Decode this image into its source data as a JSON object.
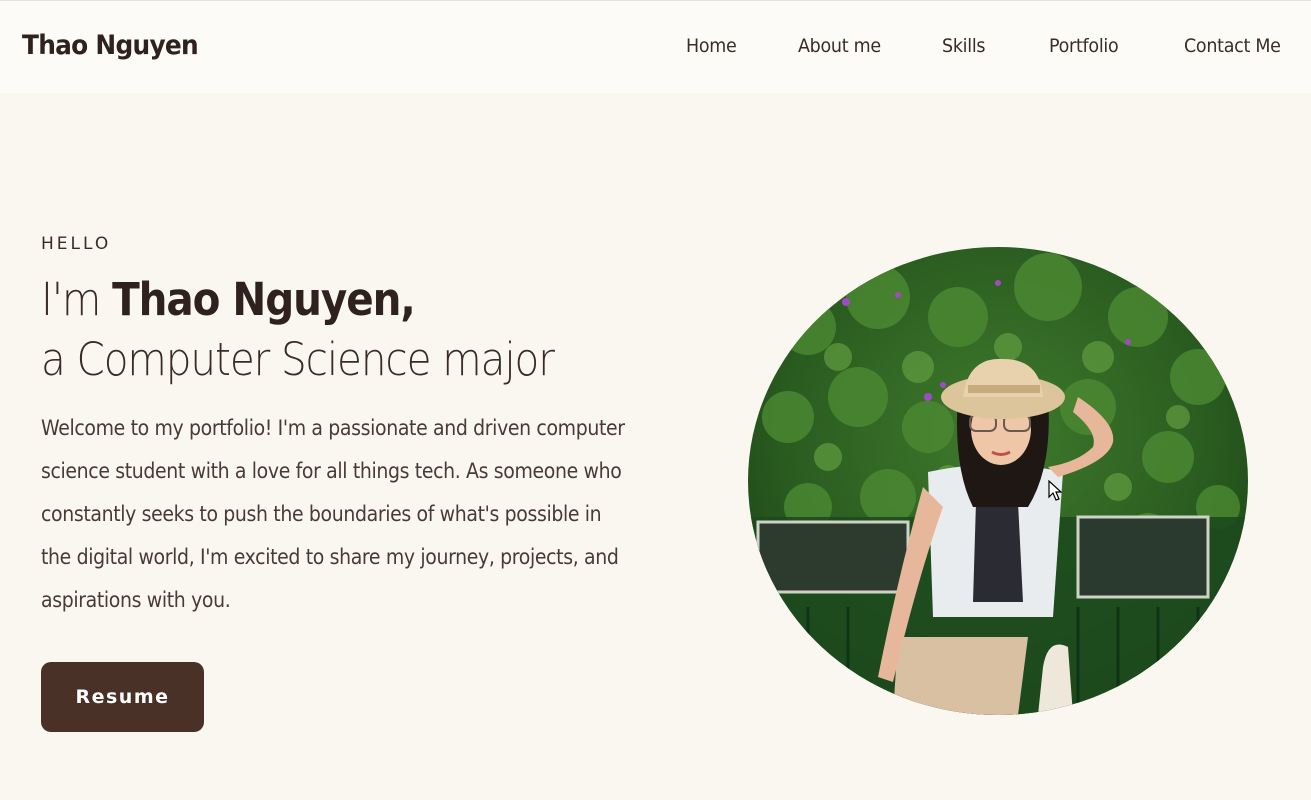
{
  "header": {
    "brand": "Thao Nguyen",
    "nav": [
      "Home",
      "About me",
      "Skills",
      "Portfolio",
      "Contact Me"
    ]
  },
  "hero": {
    "eyebrow": "HELLO",
    "greeting_prefix": "I'm ",
    "name": "Thao Nguyen,",
    "role": "a Computer Science major",
    "intro": "Welcome to my portfolio! I'm a passionate and driven computer science student with a love for all things tech. As someone who constantly seeks to push the boundaries of what's possible in the digital world, I'm excited to share my journey, projects, and aspirations with you.",
    "resume_label": "Resume"
  },
  "colors": {
    "background": "#faf7f1",
    "header_background": "#fcfbf8",
    "text": "#3a2b26",
    "button": "#4a3128"
  },
  "icons": {
    "cursor": "mouse-pointer-icon"
  }
}
